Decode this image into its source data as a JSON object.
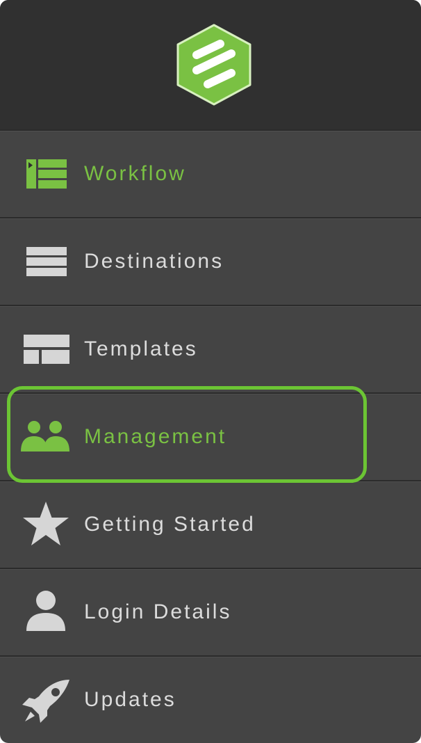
{
  "colors": {
    "panel_bg": "#444444",
    "header_bg": "#303030",
    "accent_green": "#7ac143",
    "highlight_ring": "#6cc534",
    "text_default": "#dcdcdc",
    "icon_default": "#d6d6d6"
  },
  "header": {
    "logo_icon": "hexagon-stripes-logo"
  },
  "menu": {
    "items": [
      {
        "label": "Workflow",
        "icon": "workflow-list-icon",
        "state": "active"
      },
      {
        "label": "Destinations",
        "icon": "stacked-bars-icon",
        "state": "default"
      },
      {
        "label": "Templates",
        "icon": "layout-grid-icon",
        "state": "default"
      },
      {
        "label": "Management",
        "icon": "users-group-icon",
        "state": "highlighted"
      },
      {
        "label": "Getting Started",
        "icon": "star-icon",
        "state": "default"
      },
      {
        "label": "Login Details",
        "icon": "user-icon",
        "state": "default"
      },
      {
        "label": "Updates",
        "icon": "rocket-icon",
        "state": "default"
      }
    ]
  }
}
